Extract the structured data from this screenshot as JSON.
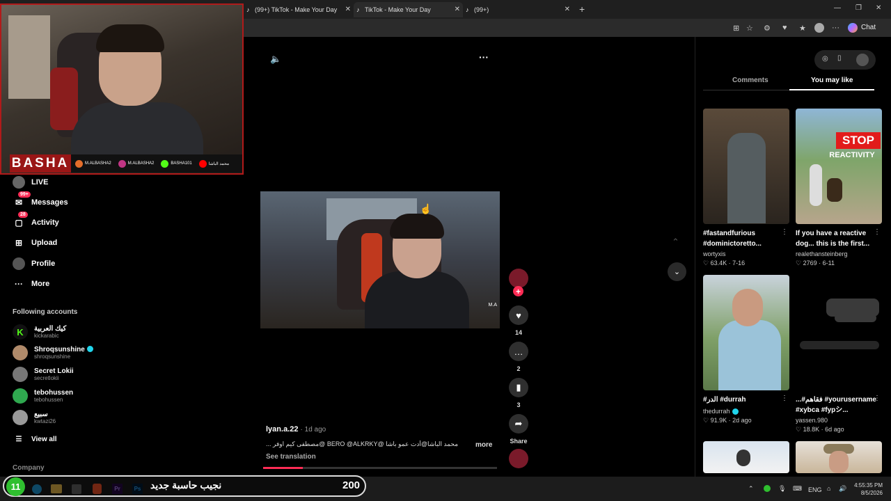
{
  "browser": {
    "tabs": [
      {
        "label": "",
        "active": false
      },
      {
        "label": "(99+) TikTok - Make Your Day",
        "active": false
      },
      {
        "label": "TikTok - Make Your Day",
        "active": true
      },
      {
        "label": "(99+)",
        "active": false
      }
    ],
    "chat_label": "Chat"
  },
  "stream_overlay": {
    "name": "BASHA",
    "socials": [
      {
        "handle": "M.ALBASHA2",
        "color": "#e46d2a"
      },
      {
        "handle": "M.ALBASHA2",
        "color": "#c13584"
      },
      {
        "handle": "BASHA101",
        "color": "#53fc18"
      },
      {
        "handle": "محمد الباشا",
        "color": "#ff0000"
      }
    ]
  },
  "sidebar": {
    "items": [
      {
        "label": "LIVE",
        "icon": "live-icon"
      },
      {
        "label": "Messages",
        "icon": "messages-icon",
        "badge": "99+"
      },
      {
        "label": "Activity",
        "icon": "activity-icon",
        "badge": "28"
      },
      {
        "label": "Upload",
        "icon": "upload-icon"
      },
      {
        "label": "Profile",
        "icon": "profile-icon"
      },
      {
        "label": "More",
        "icon": "more-icon"
      }
    ],
    "following_title": "Following accounts",
    "following": [
      {
        "name": "كيك العربية",
        "handle": "kickarabic",
        "verified": false,
        "color": "#53fc18"
      },
      {
        "name": "Shroqsunshine",
        "handle": "shroqsunshine",
        "verified": true,
        "color": "#b08a6a"
      },
      {
        "name": "Secret Lokii",
        "handle": "secretlokii",
        "verified": false,
        "color": "#777"
      },
      {
        "name": "tebohussen",
        "handle": "tebohussen",
        "verified": false,
        "color": "#2fa84f"
      },
      {
        "name": "سبيع",
        "handle": "kwtazi26",
        "verified": false,
        "color": "#999"
      }
    ],
    "view_all": "View all",
    "company": "Company"
  },
  "player": {
    "username": "lyan.a.22",
    "time": "1d ago",
    "caption": "محمد الباشا@أدت عمو باشا @BERO @ALKRKY @مصطفى كيم اوفر ...",
    "more": "more",
    "see_translation": "See translation",
    "watermark": "M.A",
    "likes": "14",
    "comments": "2",
    "saves": "3",
    "share": "Share",
    "progress": 0.17
  },
  "right_panel": {
    "tabs": [
      "Comments",
      "You may like"
    ],
    "active_tab": "You may like",
    "cards": [
      {
        "caption1": "#fastandfurious",
        "caption2": "#dominictoretto...",
        "user": "wortyxis",
        "verified": false,
        "likes": "63.4K",
        "date": "7-16"
      },
      {
        "caption1": "If you have a reactive",
        "caption2": "dog... this is the first...",
        "user": "realethansteinberg",
        "verified": false,
        "likes": "2769",
        "date": "6-11",
        "thumb_text1": "STOP",
        "thumb_text2": "REACTIVITY"
      },
      {
        "caption1": "#الدر #durrah",
        "caption2": "",
        "user": "thedurrah",
        "verified": true,
        "likes": "91.9K",
        "date": "2d ago"
      },
      {
        "caption1": "...#فقاهم #yourusername",
        "caption2": "#xybca #fypシ...",
        "user": "yassen.980",
        "verified": false,
        "likes": "18.8K",
        "date": "6d ago"
      }
    ]
  },
  "taskbar": {
    "overlay_number": "11",
    "overlay_text": "نجيب حاسبة جديد",
    "overlay_count": "200",
    "language": "ENG",
    "time": "4:55:35 PM",
    "date": "8/5/2026"
  }
}
